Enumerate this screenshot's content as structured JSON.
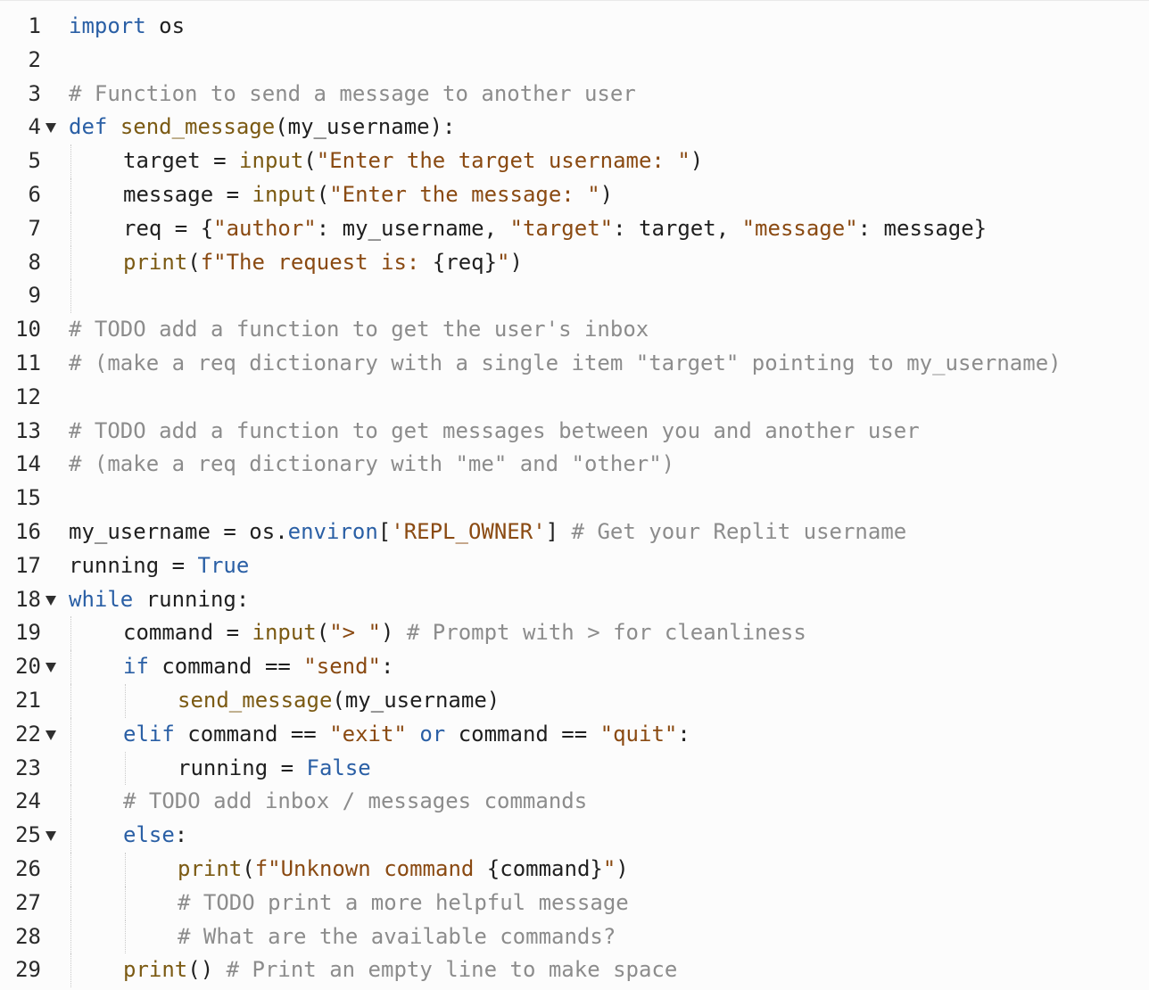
{
  "editor": {
    "lines": [
      {
        "n": "1",
        "fold": false,
        "indent": 0,
        "tokens": [
          [
            "kw",
            "import"
          ],
          [
            "txt",
            " os"
          ]
        ]
      },
      {
        "n": "2",
        "fold": false,
        "indent": 0,
        "tokens": []
      },
      {
        "n": "3",
        "fold": false,
        "indent": 0,
        "tokens": [
          [
            "com",
            "# Function to send a message to another user"
          ]
        ]
      },
      {
        "n": "4",
        "fold": true,
        "indent": 0,
        "tokens": [
          [
            "kw",
            "def"
          ],
          [
            "txt",
            " "
          ],
          [
            "fn",
            "send_message"
          ],
          [
            "txt",
            "(my_username):"
          ]
        ]
      },
      {
        "n": "5",
        "fold": false,
        "indent": 1,
        "tokens": [
          [
            "txt",
            "target = "
          ],
          [
            "fn",
            "input"
          ],
          [
            "txt",
            "("
          ],
          [
            "str",
            "\"Enter the target username: \""
          ],
          [
            "txt",
            ")"
          ]
        ]
      },
      {
        "n": "6",
        "fold": false,
        "indent": 1,
        "tokens": [
          [
            "txt",
            "message = "
          ],
          [
            "fn",
            "input"
          ],
          [
            "txt",
            "("
          ],
          [
            "str",
            "\"Enter the message: \""
          ],
          [
            "txt",
            ")"
          ]
        ]
      },
      {
        "n": "7",
        "fold": false,
        "indent": 1,
        "tokens": [
          [
            "txt",
            "req = {"
          ],
          [
            "str",
            "\"author\""
          ],
          [
            "txt",
            ": my_username, "
          ],
          [
            "str",
            "\"target\""
          ],
          [
            "txt",
            ": target, "
          ],
          [
            "str",
            "\"message\""
          ],
          [
            "txt",
            ": message}"
          ]
        ]
      },
      {
        "n": "8",
        "fold": false,
        "indent": 1,
        "tokens": [
          [
            "fn",
            "print"
          ],
          [
            "txt",
            "("
          ],
          [
            "str",
            "f\"The request is: "
          ],
          [
            "txt",
            "{req}"
          ],
          [
            "str",
            "\""
          ],
          [
            "txt",
            ")"
          ]
        ]
      },
      {
        "n": "9",
        "fold": false,
        "indent": 1,
        "tokens": []
      },
      {
        "n": "10",
        "fold": false,
        "indent": 0,
        "tokens": [
          [
            "com",
            "# TODO add a function to get the user's inbox"
          ]
        ]
      },
      {
        "n": "11",
        "fold": false,
        "indent": 0,
        "tokens": [
          [
            "com",
            "# (make a req dictionary with a single item \"target\" pointing to my_username)"
          ]
        ]
      },
      {
        "n": "12",
        "fold": false,
        "indent": 0,
        "tokens": []
      },
      {
        "n": "13",
        "fold": false,
        "indent": 0,
        "tokens": [
          [
            "com",
            "# TODO add a function to get messages between you and another user"
          ]
        ]
      },
      {
        "n": "14",
        "fold": false,
        "indent": 0,
        "tokens": [
          [
            "com",
            "# (make a req dictionary with \"me\" and \"other\")"
          ]
        ]
      },
      {
        "n": "15",
        "fold": false,
        "indent": 0,
        "tokens": []
      },
      {
        "n": "16",
        "fold": false,
        "indent": 0,
        "tokens": [
          [
            "txt",
            "my_username = os."
          ],
          [
            "kw",
            "environ"
          ],
          [
            "txt",
            "["
          ],
          [
            "str",
            "'REPL_OWNER'"
          ],
          [
            "txt",
            "] "
          ],
          [
            "com",
            "# Get your Replit username"
          ]
        ]
      },
      {
        "n": "17",
        "fold": false,
        "indent": 0,
        "tokens": [
          [
            "txt",
            "running = "
          ],
          [
            "kw",
            "True"
          ]
        ]
      },
      {
        "n": "18",
        "fold": true,
        "indent": 0,
        "tokens": [
          [
            "kw",
            "while"
          ],
          [
            "txt",
            " running:"
          ]
        ]
      },
      {
        "n": "19",
        "fold": false,
        "indent": 1,
        "tokens": [
          [
            "txt",
            "command = "
          ],
          [
            "fn",
            "input"
          ],
          [
            "txt",
            "("
          ],
          [
            "str",
            "\"> \""
          ],
          [
            "txt",
            ") "
          ],
          [
            "com",
            "# Prompt with > for cleanliness"
          ]
        ]
      },
      {
        "n": "20",
        "fold": true,
        "indent": 1,
        "tokens": [
          [
            "kw",
            "if"
          ],
          [
            "txt",
            " command == "
          ],
          [
            "str",
            "\"send\""
          ],
          [
            "txt",
            ":"
          ]
        ]
      },
      {
        "n": "21",
        "fold": false,
        "indent": 2,
        "tokens": [
          [
            "fn",
            "send_message"
          ],
          [
            "txt",
            "(my_username)"
          ]
        ]
      },
      {
        "n": "22",
        "fold": true,
        "indent": 1,
        "tokens": [
          [
            "kw",
            "elif"
          ],
          [
            "txt",
            " command == "
          ],
          [
            "str",
            "\"exit\""
          ],
          [
            "txt",
            " "
          ],
          [
            "kw",
            "or"
          ],
          [
            "txt",
            " command == "
          ],
          [
            "str",
            "\"quit\""
          ],
          [
            "txt",
            ":"
          ]
        ]
      },
      {
        "n": "23",
        "fold": false,
        "indent": 2,
        "tokens": [
          [
            "txt",
            "running = "
          ],
          [
            "kw",
            "False"
          ]
        ]
      },
      {
        "n": "24",
        "fold": false,
        "indent": 1,
        "tokens": [
          [
            "com",
            "# TODO add inbox / messages commands"
          ]
        ]
      },
      {
        "n": "25",
        "fold": true,
        "indent": 1,
        "tokens": [
          [
            "kw",
            "else"
          ],
          [
            "txt",
            ":"
          ]
        ]
      },
      {
        "n": "26",
        "fold": false,
        "indent": 2,
        "tokens": [
          [
            "fn",
            "print"
          ],
          [
            "txt",
            "("
          ],
          [
            "str",
            "f\"Unknown command "
          ],
          [
            "txt",
            "{command}"
          ],
          [
            "str",
            "\""
          ],
          [
            "txt",
            ")"
          ]
        ]
      },
      {
        "n": "27",
        "fold": false,
        "indent": 2,
        "tokens": [
          [
            "com",
            "# TODO print a more helpful message"
          ]
        ]
      },
      {
        "n": "28",
        "fold": false,
        "indent": 2,
        "tokens": [
          [
            "com",
            "# What are the available commands?"
          ]
        ]
      },
      {
        "n": "29",
        "fold": false,
        "indent": 1,
        "tokens": [
          [
            "fn",
            "print"
          ],
          [
            "txt",
            "() "
          ],
          [
            "com",
            "# Print an empty line to make space"
          ]
        ]
      }
    ]
  }
}
